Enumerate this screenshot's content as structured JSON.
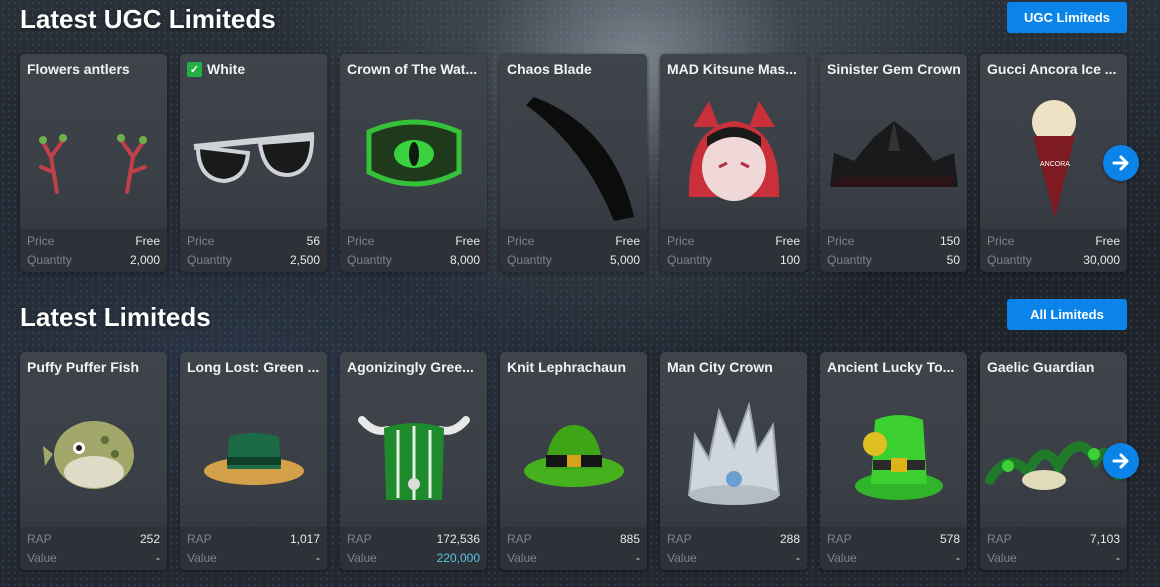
{
  "ugc": {
    "title": "Latest UGC Limiteds",
    "button": "UGC Limiteds",
    "labels": {
      "a": "Price",
      "b": "Quantity"
    },
    "items": [
      {
        "name": "Flowers antlers",
        "verified": false,
        "icon": "antlers-icon",
        "a": "Free",
        "b": "2,000"
      },
      {
        "name": "White",
        "verified": true,
        "icon": "sunglasses-icon",
        "a": "56",
        "b": "2,500"
      },
      {
        "name": "Crown of The Wat...",
        "verified": false,
        "icon": "green-eye-crown-icon",
        "a": "Free",
        "b": "8,000"
      },
      {
        "name": "Chaos Blade",
        "verified": false,
        "icon": "black-blade-icon",
        "a": "Free",
        "b": "5,000"
      },
      {
        "name": "MAD Kitsune Mas...",
        "verified": false,
        "icon": "kitsune-mask-icon",
        "a": "Free",
        "b": "100"
      },
      {
        "name": "Sinister Gem Crown",
        "verified": false,
        "icon": "black-crown-icon",
        "a": "150",
        "b": "50"
      },
      {
        "name": "Gucci Ancora Ice ...",
        "verified": false,
        "icon": "ice-cream-cone-icon",
        "a": "Free",
        "b": "30,000"
      }
    ]
  },
  "limiteds": {
    "title": "Latest Limiteds",
    "button": "All Limiteds",
    "labels": {
      "a": "RAP",
      "b": "Value"
    },
    "items": [
      {
        "name": "Puffy Puffer Fish",
        "icon": "puffer-fish-icon",
        "a": "252",
        "b": "-"
      },
      {
        "name": "Long Lost: Green ...",
        "icon": "green-boater-hat-icon",
        "a": "1,017",
        "b": "-"
      },
      {
        "name": "Agonizingly Gree...",
        "icon": "green-viking-helmet-icon",
        "a": "172,536",
        "b": "220,000"
      },
      {
        "name": "Knit Lephrachaun",
        "icon": "knit-leprechaun-hat-icon",
        "a": "885",
        "b": "-"
      },
      {
        "name": "Man City Crown",
        "icon": "silver-crown-icon",
        "a": "288",
        "b": "-"
      },
      {
        "name": "Ancient Lucky To...",
        "icon": "lucky-top-hat-icon",
        "a": "578",
        "b": "-"
      },
      {
        "name": "Gaelic Guardian",
        "icon": "gaelic-guardian-icon",
        "a": "7,103",
        "b": "-"
      }
    ]
  },
  "colors": {
    "accent": "#0a84e8",
    "verified": "#23b146",
    "highlight": "#58c4e0"
  }
}
